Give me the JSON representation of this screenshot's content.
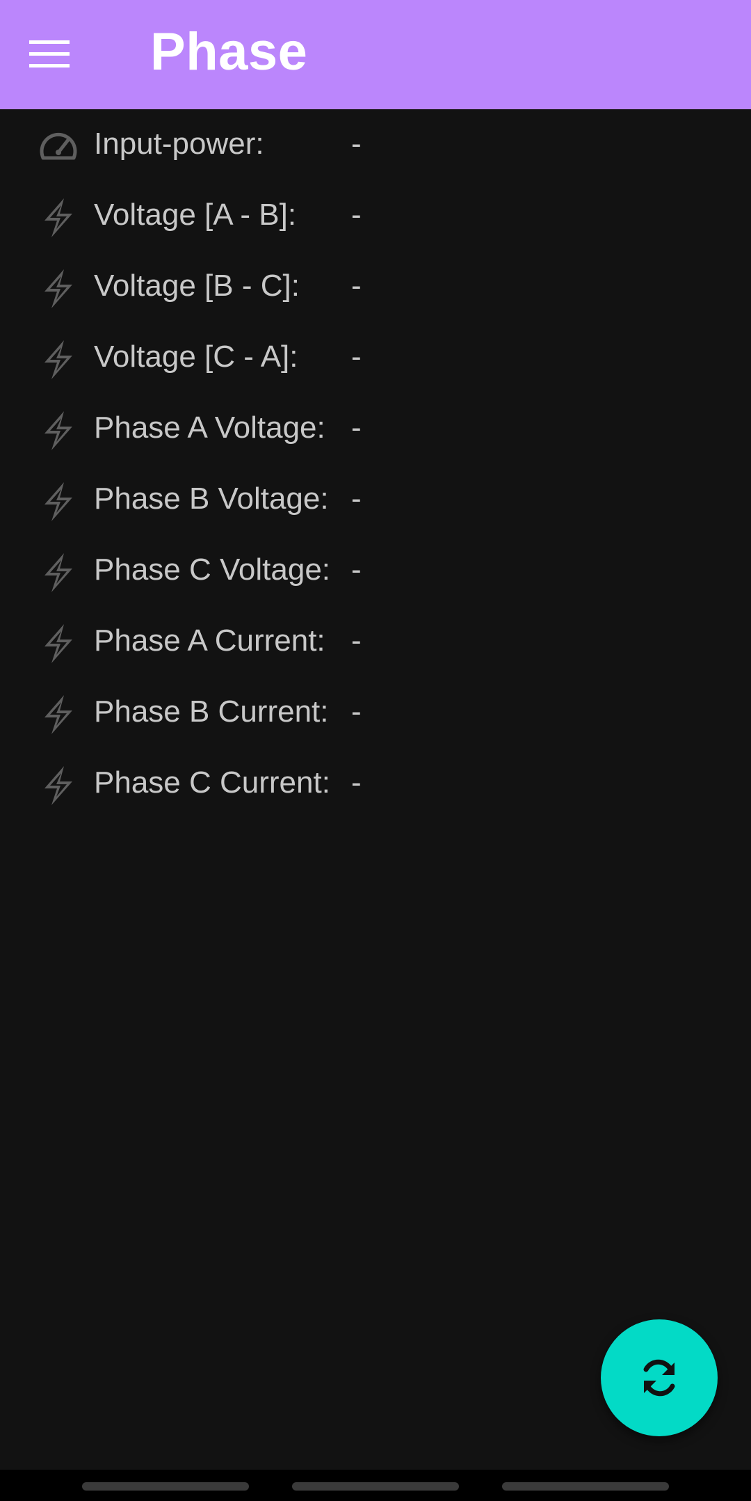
{
  "app_bar": {
    "title": "Phase",
    "background": "#bb86fc",
    "menu_icon": "hamburger-menu-icon"
  },
  "rows": [
    {
      "icon": "speedometer-icon",
      "label": "Input-power:",
      "value": "-"
    },
    {
      "icon": "lightning-bolt-icon",
      "label": "Voltage [A - B]:",
      "value": "-"
    },
    {
      "icon": "lightning-bolt-icon",
      "label": "Voltage [B - C]:",
      "value": "-"
    },
    {
      "icon": "lightning-bolt-icon",
      "label": "Voltage [C - A]:",
      "value": "-"
    },
    {
      "icon": "lightning-bolt-icon",
      "label": "Phase A Voltage:",
      "value": "-"
    },
    {
      "icon": "lightning-bolt-icon",
      "label": "Phase B Voltage:",
      "value": "-"
    },
    {
      "icon": "lightning-bolt-icon",
      "label": "Phase C Voltage:",
      "value": "-"
    },
    {
      "icon": "lightning-bolt-icon",
      "label": "Phase A Current:",
      "value": "-"
    },
    {
      "icon": "lightning-bolt-icon",
      "label": "Phase B Current:",
      "value": "-"
    },
    {
      "icon": "lightning-bolt-icon",
      "label": "Phase C Current:",
      "value": "-"
    }
  ],
  "fab": {
    "icon": "refresh-icon",
    "background": "#03dac6"
  },
  "colors": {
    "background": "#121212",
    "text": "#c8c8c8",
    "icon": "#5f5f5f"
  }
}
